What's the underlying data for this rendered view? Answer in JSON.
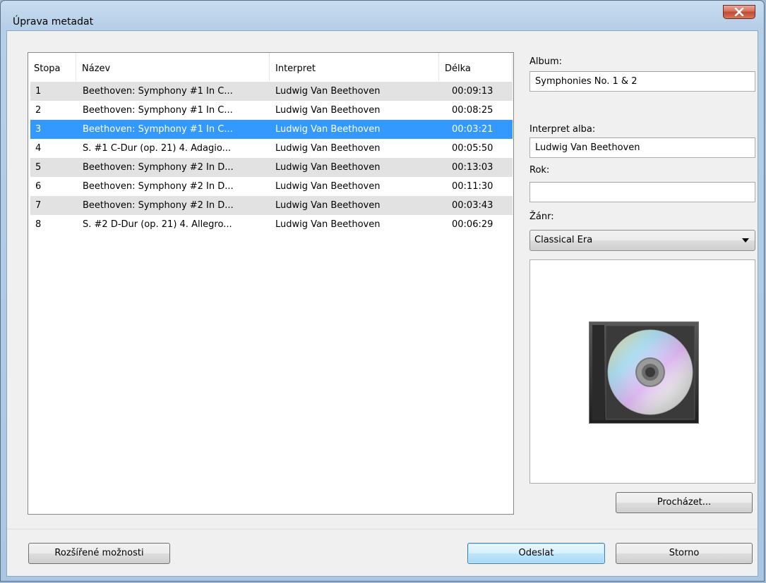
{
  "window": {
    "title": "Úprava metadat",
    "close_symbol": "✕"
  },
  "tracklist": {
    "columns": [
      "Stopa",
      "Název",
      "Interpret",
      "Délka"
    ],
    "selected_index": 2,
    "rows": [
      {
        "track": "1",
        "title": "Beethoven: Symphony #1 In C...",
        "artist": "Ludwig Van Beethoven",
        "length": "00:09:13"
      },
      {
        "track": "2",
        "title": "Beethoven: Symphony #1 In C...",
        "artist": "Ludwig Van Beethoven",
        "length": "00:08:25"
      },
      {
        "track": "3",
        "title": "Beethoven: Symphony #1 In C...",
        "artist": "Ludwig Van Beethoven",
        "length": "00:03:21"
      },
      {
        "track": "4",
        "title": "S. #1 C-Dur (op. 21) 4. Adagio...",
        "artist": "Ludwig Van Beethoven",
        "length": "00:05:50"
      },
      {
        "track": "5",
        "title": "Beethoven: Symphony #2 In D...",
        "artist": "Ludwig Van Beethoven",
        "length": "00:13:03"
      },
      {
        "track": "6",
        "title": "Beethoven: Symphony #2 In D...",
        "artist": "Ludwig Van Beethoven",
        "length": "00:11:30"
      },
      {
        "track": "7",
        "title": "Beethoven: Symphony #2 In D...",
        "artist": "Ludwig Van Beethoven",
        "length": "00:03:43"
      },
      {
        "track": "8",
        "title": "S. #2 D-Dur (op. 21) 4. Allegro...",
        "artist": "Ludwig Van Beethoven",
        "length": "00:06:29"
      }
    ]
  },
  "details": {
    "album_label": "Album:",
    "album_value": "Symphonies No. 1 & 2",
    "album_artist_label": "Interpret alba:",
    "album_artist_value": "Ludwig Van Beethoven",
    "year_label": "Rok:",
    "year_value": "",
    "genre_label": "Žánr:",
    "genre_value": "Classical Era",
    "art_icon": "cd-case-icon",
    "browse_label": "Procházet..."
  },
  "footer": {
    "advanced_label": "Rozšířené možnosti",
    "submit_label": "Odeslat",
    "cancel_label": "Storno"
  },
  "colors": {
    "selection": "#3399ff",
    "alt_row": "#e2e2e2",
    "close_button": "#c75b43"
  }
}
